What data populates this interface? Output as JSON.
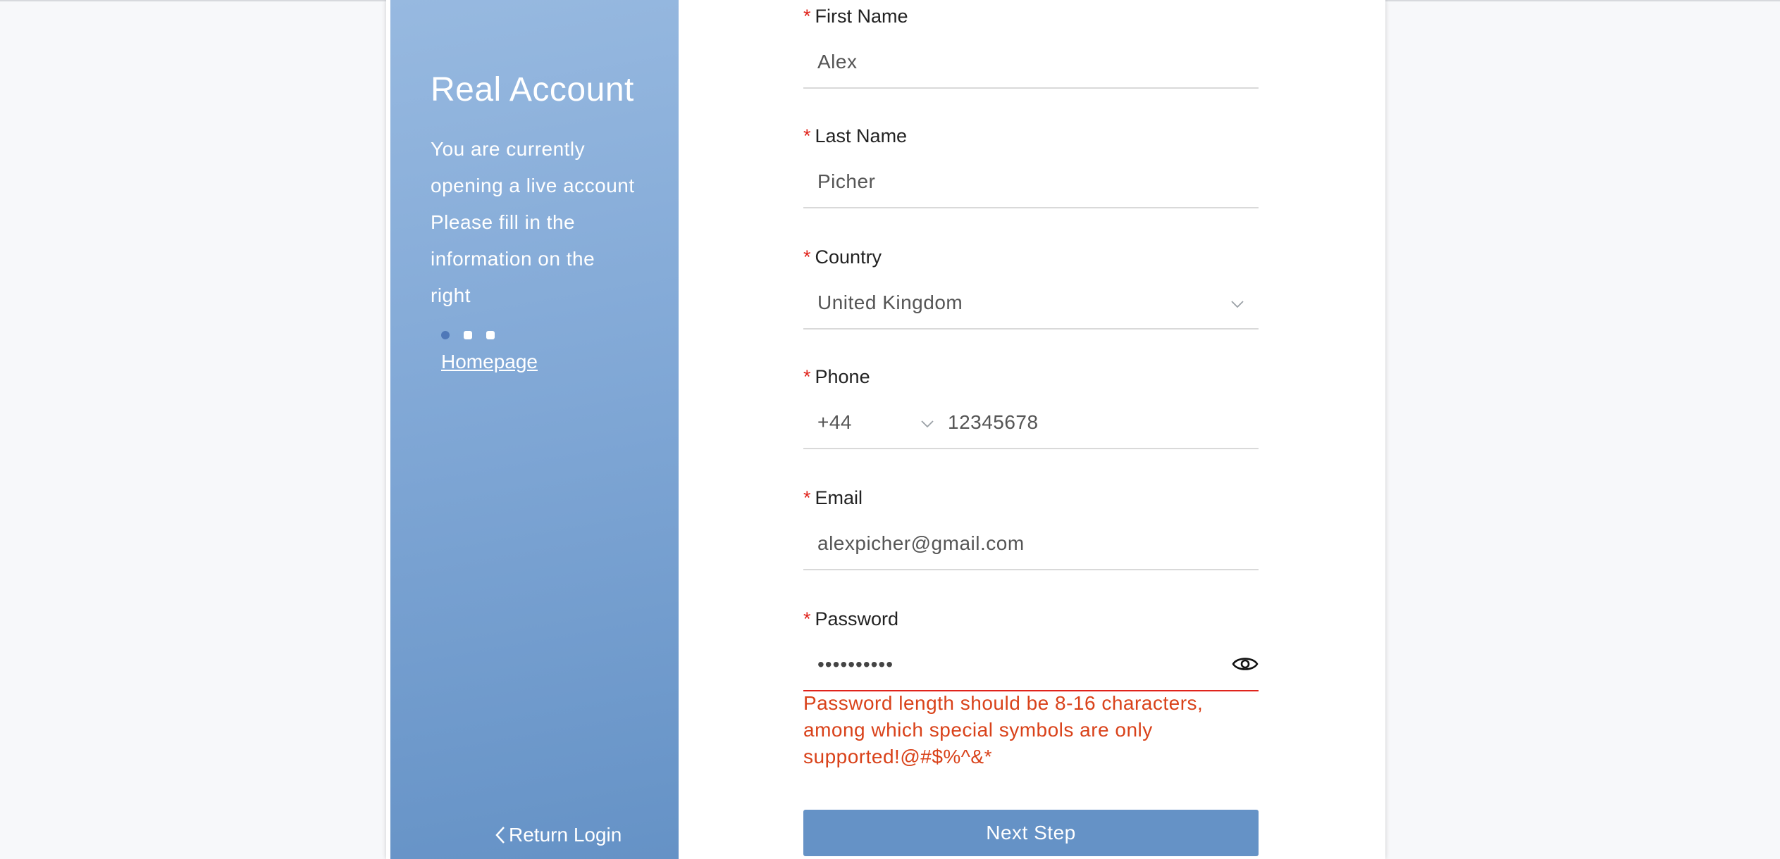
{
  "sidebar": {
    "title": "Real Account",
    "description_lines": [
      "You are currently",
      "opening a live account",
      "Please fill in the",
      "information on the",
      "right"
    ],
    "homepage_link": "Homepage",
    "return_login": "Return Login",
    "step_dots": 3,
    "active_step": 1
  },
  "form": {
    "first_name": {
      "label": "First Name",
      "value": "Alex",
      "required": true
    },
    "last_name": {
      "label": "Last Name",
      "value": "Picher",
      "required": true
    },
    "country": {
      "label": "Country",
      "value": "United Kingdom",
      "required": true
    },
    "phone": {
      "label": "Phone",
      "code": "+44",
      "number": "12345678",
      "required": true
    },
    "email": {
      "label": "Email",
      "value": "alexpicher@gmail.com",
      "required": true
    },
    "password": {
      "label": "Password",
      "value_masked": "••••••••••",
      "required": true,
      "error": "Password length should be 8-16 characters, among which special symbols are only supported!@#$%^&*"
    },
    "next_button": "Next Step"
  },
  "colors": {
    "accent": "#6592c6",
    "required_star": "#e0241c",
    "error_text": "#d9421a"
  },
  "icons": {
    "dropdown": "chevron-down-icon",
    "show_password": "eye-icon",
    "back": "chevron-left-icon"
  }
}
